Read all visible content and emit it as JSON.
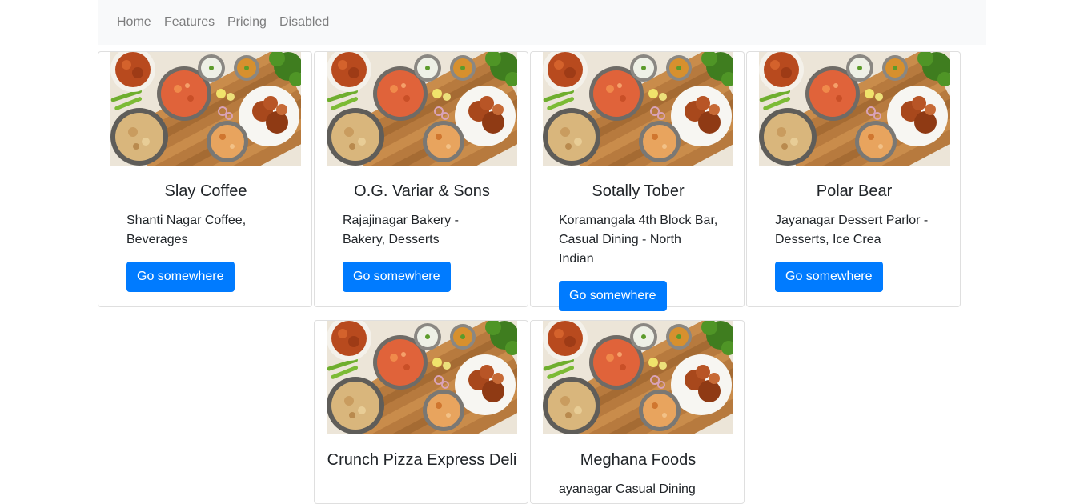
{
  "nav": {
    "links": [
      "Home",
      "Features",
      "Pricing",
      "Disabled"
    ]
  },
  "colors": {
    "primary": "#007bff",
    "navbar_bg": "#f8f9fa",
    "nav_link": "#7f7f7f"
  },
  "cards": [
    {
      "title": "Slay Coffee",
      "text": "Shanti Nagar Coffee, Beverages",
      "button": "Go somewhere"
    },
    {
      "title": "O.G. Variar & Sons",
      "text": "Rajajinagar Bakery - Bakery, Desserts",
      "button": "Go somewhere"
    },
    {
      "title": "Sotally Tober",
      "text": "Koramangala 4th Block Bar, Casual Dining - North Indian",
      "button": "Go somewhere"
    },
    {
      "title": "Polar Bear",
      "text": "Jayanagar Dessert Parlor - Desserts, Ice Crea",
      "button": "Go somewhere"
    },
    {
      "title": "Crunch Pizza Express Deli",
      "text": "",
      "button": ""
    },
    {
      "title": "Meghana Foods",
      "text": "ayanagar Casual Dining",
      "button": ""
    }
  ]
}
